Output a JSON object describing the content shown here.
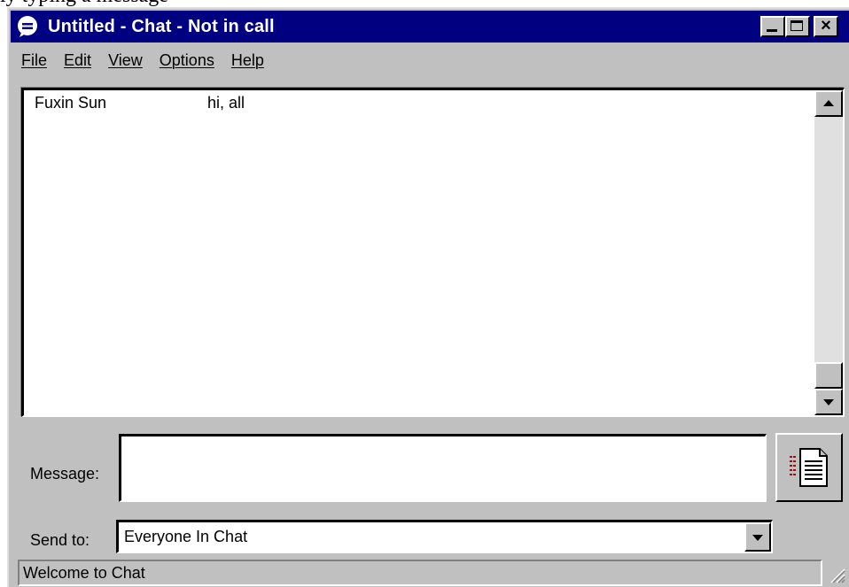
{
  "window": {
    "title": "Untitled - Chat - Not in call"
  },
  "menu": {
    "items": [
      {
        "label": "File"
      },
      {
        "label": "Edit"
      },
      {
        "label": "View"
      },
      {
        "label": "Options"
      },
      {
        "label": "Help"
      }
    ]
  },
  "chat_log": {
    "entries": [
      {
        "sender": "Fuxin Sun",
        "message": "hi, all"
      }
    ]
  },
  "compose": {
    "message_label": "Message:",
    "message_value": "",
    "send_to_label": "Send to:",
    "send_to_value": "Everyone In Chat"
  },
  "status": {
    "text": "Welcome to Chat"
  },
  "background": {
    "partial_text": "ly typing a message"
  },
  "icons": {
    "title": "chat-bubble-icon",
    "send": "send-document-icon",
    "dropdown": "chevron-down-icon"
  },
  "colors": {
    "titlebar": "#000080",
    "face": "#c0c0c0"
  }
}
